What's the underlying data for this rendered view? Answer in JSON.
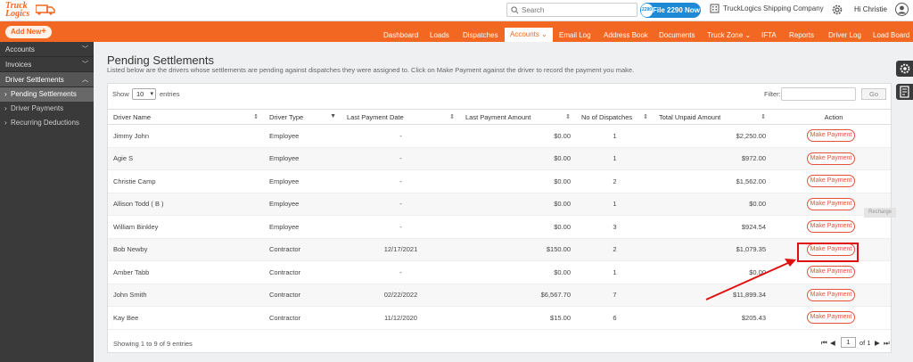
{
  "brand": {
    "logo_line1": "Truck",
    "logo_line2": "Logics",
    "color": "#f26722"
  },
  "header": {
    "search_placeholder": "Search",
    "file_badge": "2290",
    "file_button": "File 2290 Now",
    "company": "TruckLogics Shipping Company",
    "greeting": "Hi Christie",
    "icons": [
      "search-icon",
      "building-icon",
      "gear-icon",
      "user-icon"
    ]
  },
  "nav": {
    "add_new": "Add New",
    "items": [
      "Dashboard",
      "Loads",
      "Dispatches",
      "Accounts",
      "Email Log",
      "Address Book",
      "Documents",
      "Truck Zone",
      "IFTA",
      "Reports",
      "Driver Log",
      "Load Board"
    ],
    "active": "Accounts"
  },
  "sidebar": {
    "sections": [
      {
        "label": "Accounts"
      },
      {
        "label": "Invoices"
      },
      {
        "label": "Driver Settlements"
      }
    ],
    "sub_items": [
      {
        "label": "Pending Settlements",
        "active": true
      },
      {
        "label": "Driver Payments"
      },
      {
        "label": "Recurring Deductions"
      }
    ]
  },
  "page": {
    "title": "Pending Settlements",
    "description": "Listed below are the drivers whose settlements are pending against dispatches they were assigned to. Click on Make Payment against the driver to record the payment you make."
  },
  "table_controls": {
    "show_label": "Show",
    "page_size": "10",
    "entries_label": "entries",
    "filter_label": "Filter:",
    "go_label": "Go"
  },
  "table": {
    "columns": [
      "Driver Name",
      "Driver Type",
      "Last Payment Date",
      "Last Payment Amount",
      "No of Dispatches",
      "Total Unpaid Amount",
      "Action"
    ],
    "rows": [
      [
        "Jimmy John",
        "Employee",
        "-",
        "$0.00",
        "1",
        "$2,250.00",
        "Make Payment"
      ],
      [
        "Agie S",
        "Employee",
        "-",
        "$0.00",
        "1",
        "$972.00",
        "Make Payment"
      ],
      [
        "Christie Camp",
        "Employee",
        "-",
        "$0.00",
        "2",
        "$1,562.00",
        "Make Payment"
      ],
      [
        "Allison Todd ( B )",
        "Employee",
        "-",
        "$0.00",
        "1",
        "$0.00",
        "Make Payment"
      ],
      [
        "William Binkley",
        "Employee",
        "-",
        "$0.00",
        "3",
        "$924.54",
        "Make Payment"
      ],
      [
        "Bob Newby",
        "Contractor",
        "12/17/2021",
        "$150.00",
        "2",
        "$1,079.35",
        "Make Payment"
      ],
      [
        "Amber Tabb",
        "Contractor",
        "-",
        "$0.00",
        "1",
        "$0.00",
        "Make Payment"
      ],
      [
        "John Smith",
        "Contractor",
        "02/22/2022",
        "$6,567.70",
        "7",
        "$11,899.34",
        "Make Payment"
      ],
      [
        "Kay Bee",
        "Contractor",
        "11/12/2020",
        "$15.00",
        "6",
        "$205.43",
        "Make Payment"
      ]
    ]
  },
  "footer": {
    "info": "Showing 1 to 9 of 9 entries",
    "page": "1",
    "of_label": "of 1"
  },
  "tooltip": "Recharge",
  "annotation_color": "#e01010"
}
